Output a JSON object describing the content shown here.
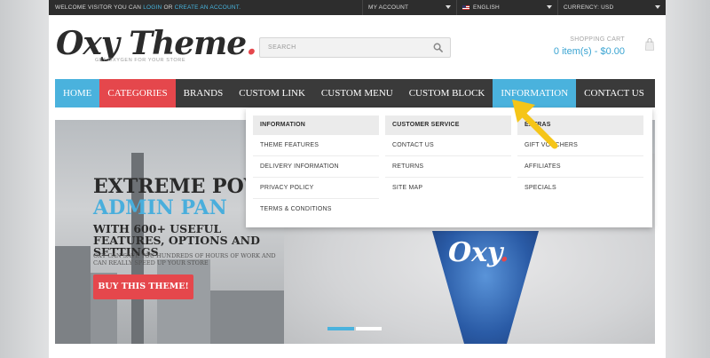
{
  "topbar": {
    "welcome_prefix": "WELCOME VISITOR YOU CAN",
    "login": "LOGIN",
    "or": "OR",
    "create_account": "CREATE AN ACCOUNT.",
    "account": "MY ACCOUNT",
    "language": "ENGLISH",
    "currency": "CURRENCY: USD"
  },
  "header": {
    "logo": "Oxy Theme",
    "logo_dot": ".",
    "tagline": "GET OXYGEN FOR YOUR STORE",
    "search_placeholder": "SEARCH",
    "cart_label": "SHOPPING CART",
    "cart_value": "0 item(s) - $0.00"
  },
  "nav": {
    "items": [
      "HOME",
      "CATEGORIES",
      "BRANDS",
      "CUSTOM LINK",
      "CUSTOM MENU",
      "CUSTOM BLOCK",
      "INFORMATION",
      "CONTACT US"
    ]
  },
  "dropdown": {
    "columns": [
      {
        "title": "INFORMATION",
        "links": [
          "THEME FEATURES",
          "DELIVERY INFORMATION",
          "PRIVACY POLICY",
          "TERMS & CONDITIONS"
        ]
      },
      {
        "title": "CUSTOMER SERVICE",
        "links": [
          "CONTACT US",
          "RETURNS",
          "SITE MAP"
        ]
      },
      {
        "title": "EXTRAS",
        "links": [
          "GIFT VOUCHERS",
          "AFFILIATES",
          "SPECIALS"
        ]
      }
    ]
  },
  "hero": {
    "line1": "EXTREME POW",
    "line2": "ADMIN PAN",
    "line3": "WITH 600+ USEFUL FEATURES, OPTIONS AND SETTINGS",
    "sub": "OXY CAN SAVE YOU HUNDREDS OF HOURS OF WORK AND CAN REALLY SPEED UP YOUR STORE",
    "button": "BUY THIS THEME!",
    "shirt_logo": "Oxy",
    "shirt_dot": "."
  },
  "colors": {
    "accent_blue": "#4ab2dd",
    "accent_red": "#e5474c",
    "nav_bg": "#3a3a3a",
    "arrow": "#f5c518"
  }
}
